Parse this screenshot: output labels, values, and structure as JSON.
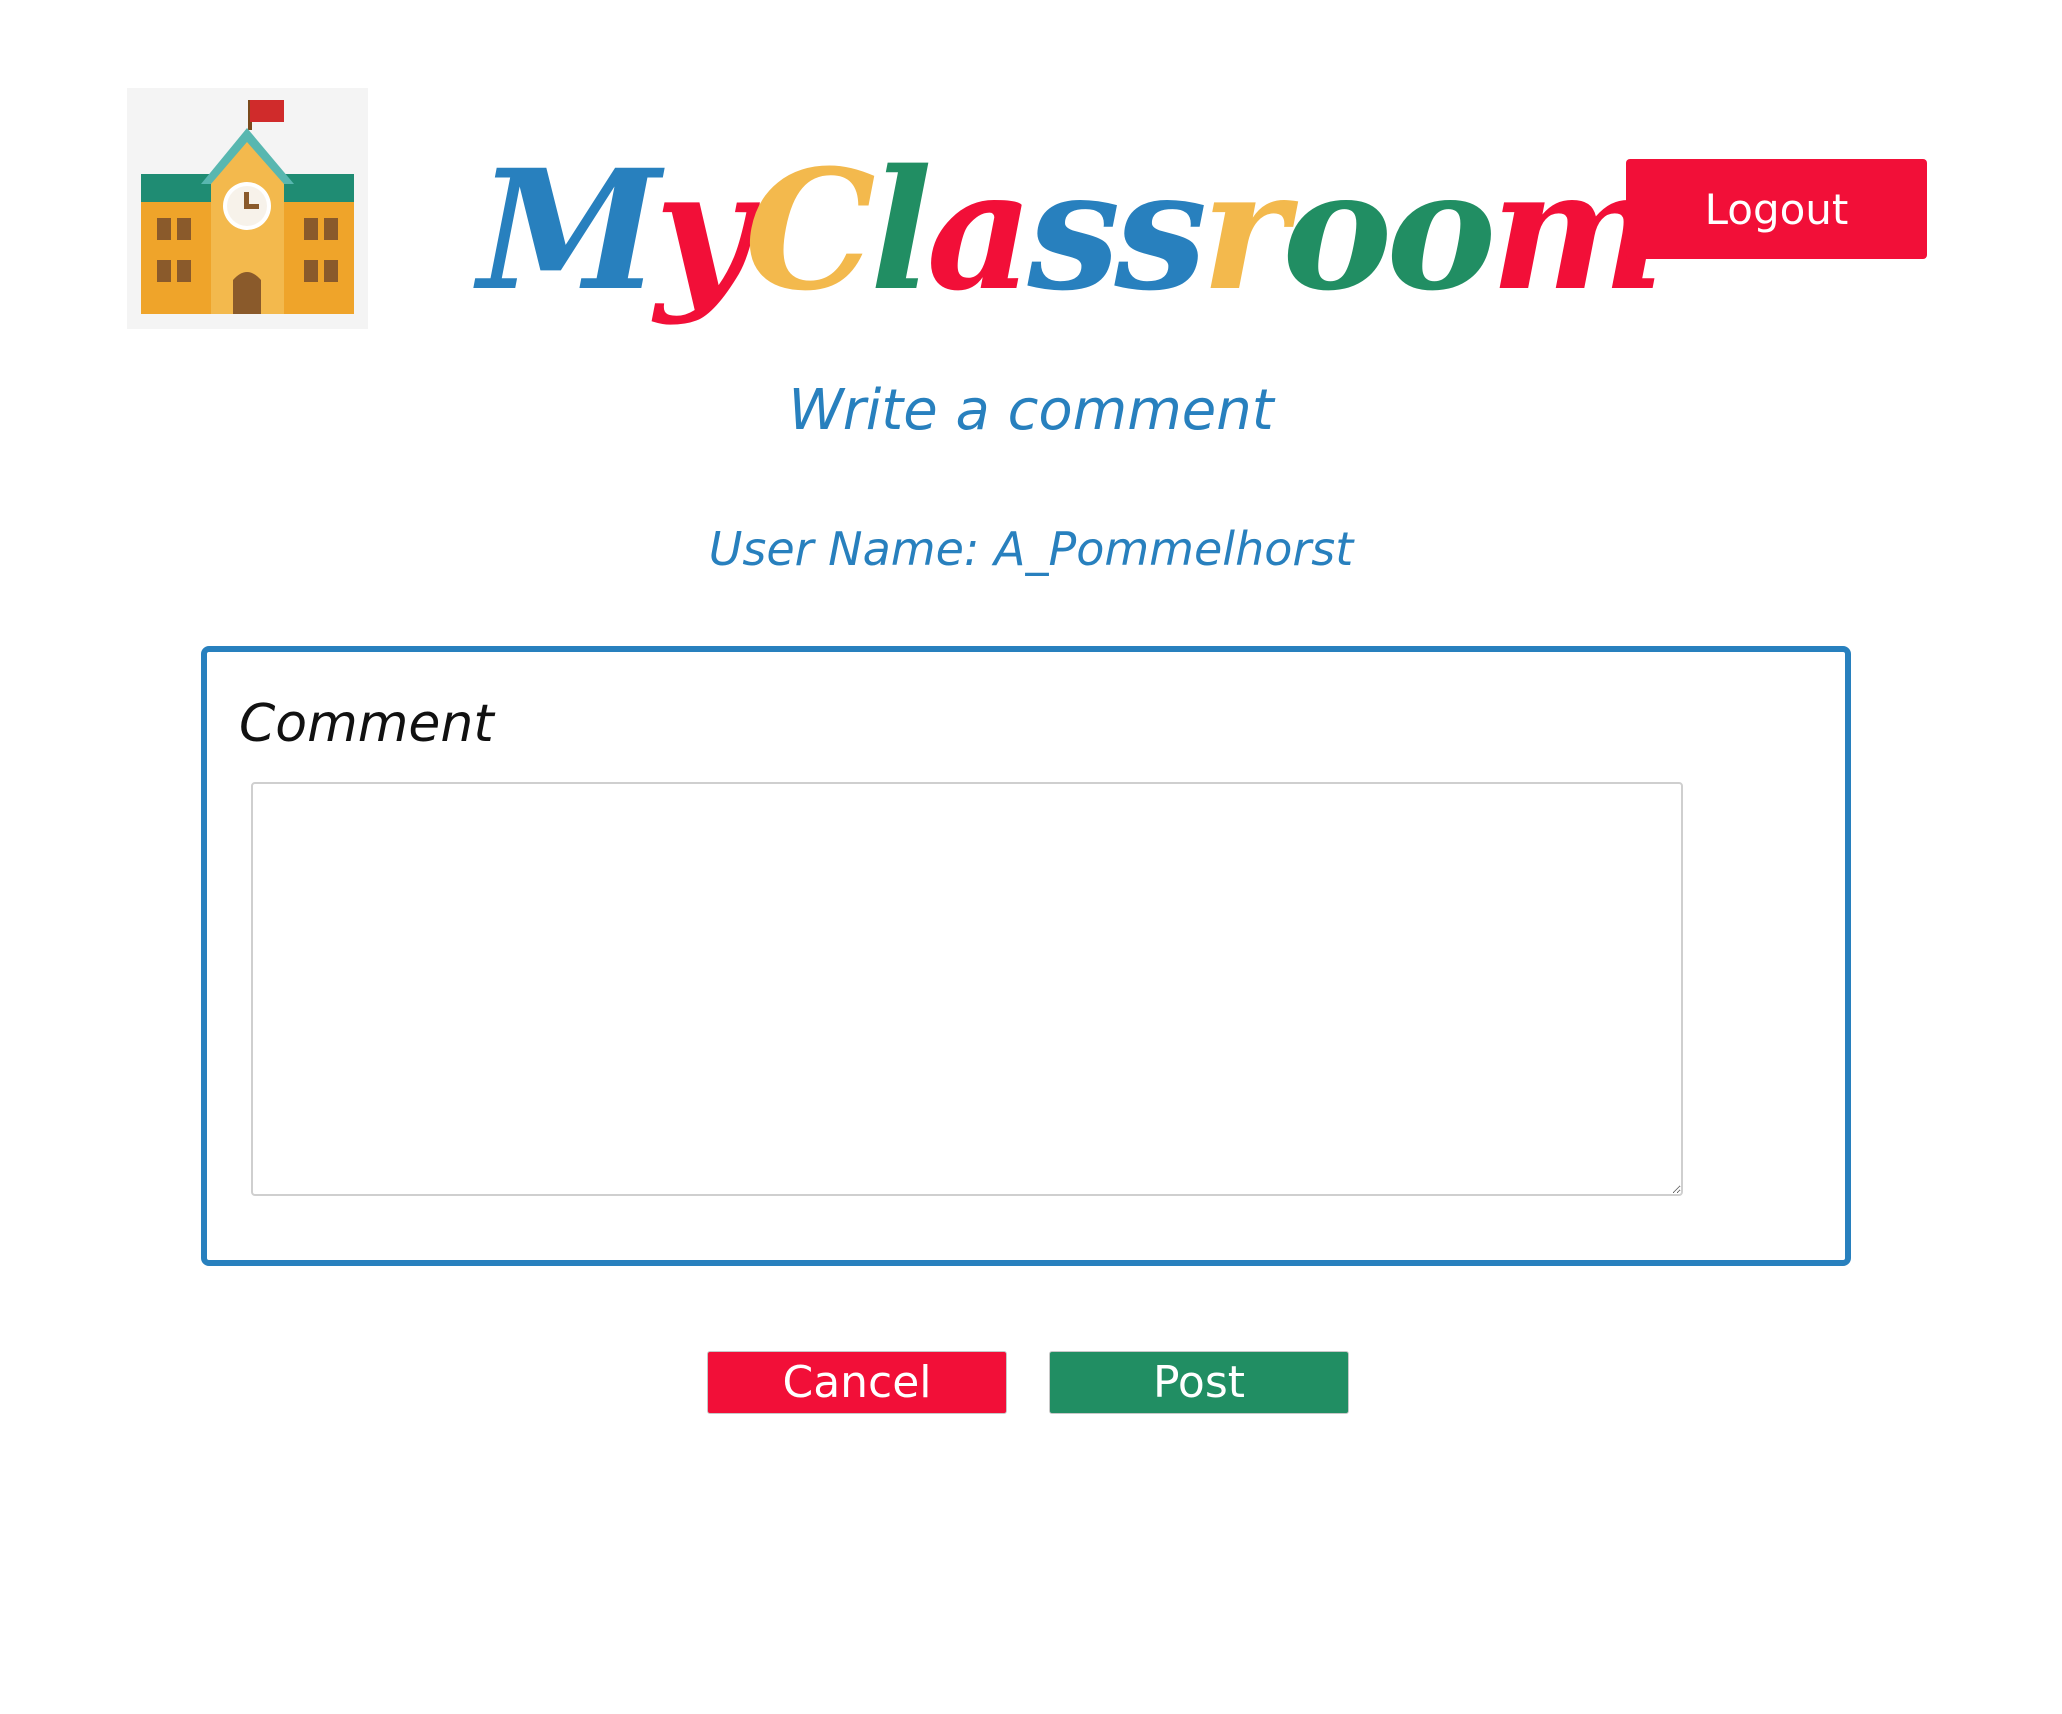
{
  "header": {
    "brand_letters": [
      {
        "char": "M",
        "color": "#2880be"
      },
      {
        "char": "y",
        "color": "#f20f38"
      },
      {
        "char": "C",
        "color": "#f3b94d"
      },
      {
        "char": "l",
        "color": "#218e63"
      },
      {
        "char": "a",
        "color": "#f20f38"
      },
      {
        "char": "s",
        "color": "#2880be"
      },
      {
        "char": "s",
        "color": "#2880be"
      },
      {
        "char": "r",
        "color": "#f3b94d"
      },
      {
        "char": "o",
        "color": "#218e63"
      },
      {
        "char": "o",
        "color": "#218e63"
      },
      {
        "char": "m",
        "color": "#f20f38"
      }
    ],
    "logout_label": "Logout",
    "logo_icon": "school-building-icon"
  },
  "main": {
    "title": "Write a comment",
    "user_name_label": "User Name:",
    "user_name": "A_Pommelhorst",
    "comment_label": "Comment",
    "comment_value": ""
  },
  "actions": {
    "cancel_label": "Cancel",
    "post_label": "Post"
  },
  "colors": {
    "primary_blue": "#2880be",
    "danger_red": "#f20f38",
    "success_green": "#218e63",
    "accent_yellow": "#f3b94d"
  }
}
